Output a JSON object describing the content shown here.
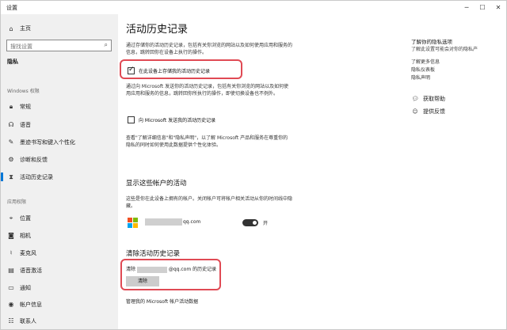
{
  "window": {
    "title": "设置"
  },
  "sidebar": {
    "home": "主页",
    "search_placeholder": "搜找设置",
    "category": "隐私",
    "group_windows": "Windows 权限",
    "windows_items": [
      {
        "label": "常规",
        "icon": "lock-icon"
      },
      {
        "label": "语音",
        "icon": "speech-icon"
      },
      {
        "label": "墨迹书写和键入个性化",
        "icon": "pen-icon"
      },
      {
        "label": "诊断和反馈",
        "icon": "diagnostics-icon"
      },
      {
        "label": "活动历史记录",
        "icon": "history-icon"
      }
    ],
    "group_app": "应用权限",
    "app_items": [
      {
        "label": "位置",
        "icon": "location-icon"
      },
      {
        "label": "相机",
        "icon": "camera-icon"
      },
      {
        "label": "麦克风",
        "icon": "microphone-icon"
      },
      {
        "label": "语音激活",
        "icon": "voice-activation-icon"
      },
      {
        "label": "通知",
        "icon": "notification-icon"
      },
      {
        "label": "帐户信息",
        "icon": "account-info-icon"
      },
      {
        "label": "联系人",
        "icon": "contacts-icon"
      }
    ]
  },
  "main": {
    "title": "活动历史记录",
    "para1": "通过存储你的活动历史记录，包括有关你浏览的网站以及如何使用应用和服务的信息，跳转回你在设备上执行的操作。",
    "checkbox1": {
      "label": "在此设备上存储我的活动历史记录",
      "checked": true
    },
    "para2": "通过向 Microsoft 发送你的活动历史记录，包括有关你浏览的网站以及如何使用应用和服务的信息，跳转回你所执行的操作，即使切换设备也不例外。",
    "checkbox2": {
      "label": "向 Microsoft 发送我的活动历史记录",
      "checked": false
    },
    "para3": "查看\"了解详细信息\"和\"隐私声明\"，以了解 Microsoft 产品和服务在尊重你的隐私的同时如何使用此数据提供个性化体验。",
    "section_accounts": "显示这些帐户的活动",
    "accounts_desc": "这些是你在此设备上拥有的帐户。关闭帐户可将帐户相关活动从你的时间线中隐藏。",
    "account_email_suffix": "qq.com",
    "toggle_label": "开",
    "toggle_on": true,
    "section_clear": "清除活动历史记录",
    "clear_prefix": "清除",
    "clear_suffix": "@qq.com 的历史记录",
    "clear_button": "清除",
    "manage_link": "管理我的 Microsoft 帐户活动数据"
  },
  "right": {
    "title": "了解你的隐私选项",
    "subtitle": "了解此设置可能会对你的隐私产",
    "links": [
      "了解更多信息",
      "隐私仪表板",
      "隐私声明"
    ],
    "get_help": "获取帮助",
    "feedback": "提供反馈"
  },
  "colors": {
    "accent": "#0078d7",
    "highlight": "#e04a54",
    "sidebar_bg": "#f0f0f0"
  }
}
